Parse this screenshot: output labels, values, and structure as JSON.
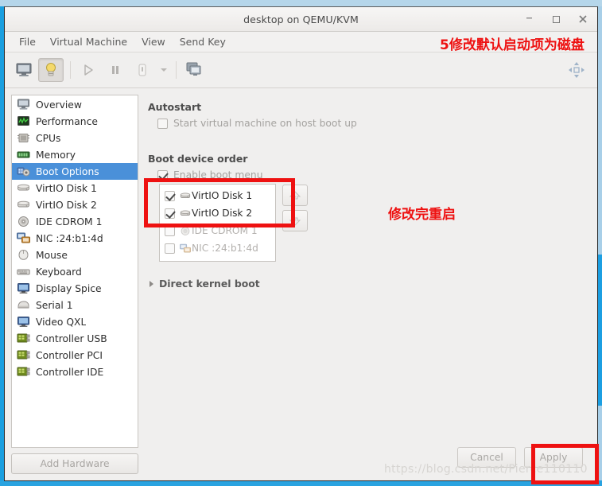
{
  "window": {
    "title": "desktop on QEMU/KVM",
    "controls": {
      "minimize": "–",
      "maximize": "□",
      "close": "✕"
    }
  },
  "menubar": {
    "items": [
      {
        "label": "File"
      },
      {
        "label": "Virtual Machine"
      },
      {
        "label": "View"
      },
      {
        "label": "Send Key"
      }
    ]
  },
  "toolbar": {
    "buttons": [
      {
        "name": "show-console-button",
        "icon": "monitor-icon",
        "pressed": false
      },
      {
        "name": "show-details-button",
        "icon": "lightbulb-icon",
        "pressed": true
      },
      {
        "name": "run-button",
        "icon": "play-icon",
        "pressed": false
      },
      {
        "name": "pause-button",
        "icon": "pause-icon",
        "pressed": false
      },
      {
        "name": "shutdown-button",
        "icon": "power-icon",
        "pressed": false
      },
      {
        "name": "shutdown-menu-button",
        "icon": "chevron-down-icon",
        "pressed": false
      },
      {
        "name": "snapshots-button",
        "icon": "snapshot-icon",
        "pressed": false
      }
    ],
    "fullscreen": {
      "name": "fullscreen-button",
      "icon": "fullscreen-icon"
    }
  },
  "sidebar": {
    "items": [
      {
        "label": "Overview",
        "icon": "monitor-icon",
        "selected": false
      },
      {
        "label": "Performance",
        "icon": "graph-icon",
        "selected": false
      },
      {
        "label": "CPUs",
        "icon": "cpu-icon",
        "selected": false
      },
      {
        "label": "Memory",
        "icon": "memory-icon",
        "selected": false
      },
      {
        "label": "Boot Options",
        "icon": "boot-gear-icon",
        "selected": true
      },
      {
        "label": "VirtIO Disk 1",
        "icon": "harddisk-icon",
        "selected": false
      },
      {
        "label": "VirtIO Disk 2",
        "icon": "harddisk-icon",
        "selected": false
      },
      {
        "label": "IDE CDROM 1",
        "icon": "cdrom-icon",
        "selected": false
      },
      {
        "label": "NIC :24:b1:4d",
        "icon": "network-icon",
        "selected": false
      },
      {
        "label": "Mouse",
        "icon": "mouse-icon",
        "selected": false
      },
      {
        "label": "Keyboard",
        "icon": "keyboard-icon",
        "selected": false
      },
      {
        "label": "Display Spice",
        "icon": "display-icon",
        "selected": false
      },
      {
        "label": "Serial 1",
        "icon": "serial-icon",
        "selected": false
      },
      {
        "label": "Video QXL",
        "icon": "display-icon",
        "selected": false
      },
      {
        "label": "Controller USB",
        "icon": "pcicard-icon",
        "selected": false
      },
      {
        "label": "Controller PCI",
        "icon": "pcicard-icon",
        "selected": false
      },
      {
        "label": "Controller IDE",
        "icon": "pcicard-icon",
        "selected": false
      }
    ],
    "add_hardware_label": "Add Hardware"
  },
  "content": {
    "autostart": {
      "heading": "Autostart",
      "checkbox_label": "Start virtual machine on host boot up",
      "checked": false
    },
    "boot_device_order": {
      "heading": "Boot device order",
      "enable_boot_menu_label": "Enable boot menu",
      "enable_boot_menu_checked": true,
      "devices": [
        {
          "label": "VirtIO Disk 1",
          "icon": "harddisk-icon",
          "checked": true,
          "enabled": true
        },
        {
          "label": "VirtIO Disk 2",
          "icon": "harddisk-icon",
          "checked": true,
          "enabled": true
        },
        {
          "label": "IDE CDROM 1",
          "icon": "cdrom-icon",
          "checked": false,
          "enabled": false
        },
        {
          "label": "NIC :24:b1:4d",
          "icon": "network-icon",
          "checked": false,
          "enabled": false
        }
      ],
      "move_up_icon": "arrow-up-icon",
      "move_down_icon": "arrow-down-icon"
    },
    "direct_kernel_boot": {
      "label": "Direct kernel boot",
      "expanded": false
    }
  },
  "footer": {
    "cancel_label": "Cancel",
    "apply_label": "Apply"
  },
  "annotations": {
    "top_right": "5修改默认启动项为磁盘",
    "middle": "修改完重启",
    "color": "#ee1111"
  },
  "watermark": "https://blog.csdn.net/Pierce110110"
}
